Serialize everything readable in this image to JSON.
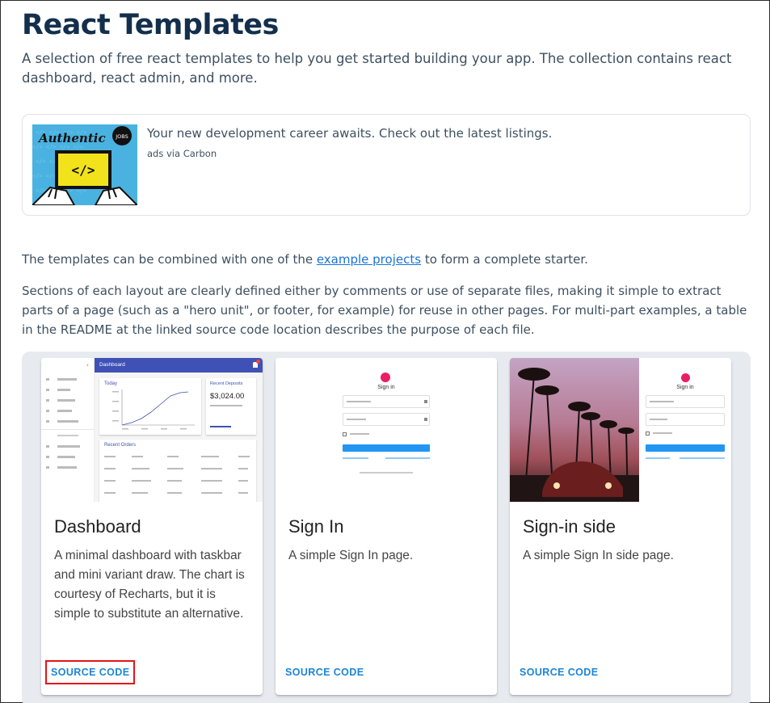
{
  "header": {
    "title": "React Templates",
    "lead": "A selection of free react templates to help you get started building your app. The collection contains react dashboard, react admin, and more."
  },
  "ad": {
    "text": "Your new development career awaits. Check out the latest listings.",
    "via": "ads via Carbon",
    "image_caption": "Authentic",
    "image_badge": "JOBS",
    "image_code": "</>"
  },
  "intro": {
    "p1_before": "The templates can be combined with one of the ",
    "p1_link": "example projects",
    "p1_after": " to form a complete starter.",
    "p2": "Sections of each layout are clearly defined either by comments or use of separate files, making it simple to extract parts of a page (such as a \"hero unit\", or footer, for example) for reuse in other pages. For multi-part examples, a table in the README at the linked source code location describes the purpose of each file."
  },
  "cards": [
    {
      "title": "Dashboard",
      "description": "A minimal dashboard with taskbar and mini variant draw. The chart is courtesy of Recharts, but it is simple to substitute an alternative.",
      "action": "SOURCE CODE",
      "thumb": {
        "topbar": "Dashboard",
        "panel1": "Today",
        "panel2": "Recent Deposits",
        "amount": "$3,024.00",
        "panel3": "Recent Orders"
      }
    },
    {
      "title": "Sign In",
      "description": "A simple Sign In page.",
      "action": "SOURCE CODE",
      "thumb": {
        "heading": "Sign in"
      }
    },
    {
      "title": "Sign-in side",
      "description": "A simple Sign In side page.",
      "action": "SOURCE CODE",
      "thumb": {
        "heading": "Sign in"
      }
    }
  ],
  "colors": {
    "title": "#132f4c",
    "link": "#1a73d6",
    "action": "#1b85d6",
    "highlight": "#e3141b",
    "dashboard_bar": "#3f51b5",
    "signin_button": "#2196f3",
    "ad_background": "#4ab2e0"
  }
}
